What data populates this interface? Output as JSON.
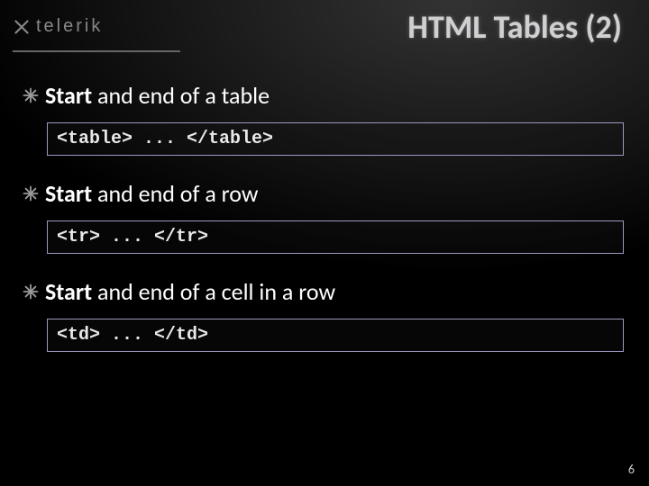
{
  "brand": {
    "name": "telerik"
  },
  "title": "HTML Tables (2)",
  "bullets": [
    {
      "bold": "Start",
      "rest": " and end of a table",
      "code": "<table> ... </table>"
    },
    {
      "bold": "Start",
      "rest": " and end of a row",
      "code": "<tr> ... </tr>"
    },
    {
      "bold": "Start",
      "rest": " and end of a cell in a row",
      "code": "<td> ... </td>"
    }
  ],
  "page_number": "6"
}
